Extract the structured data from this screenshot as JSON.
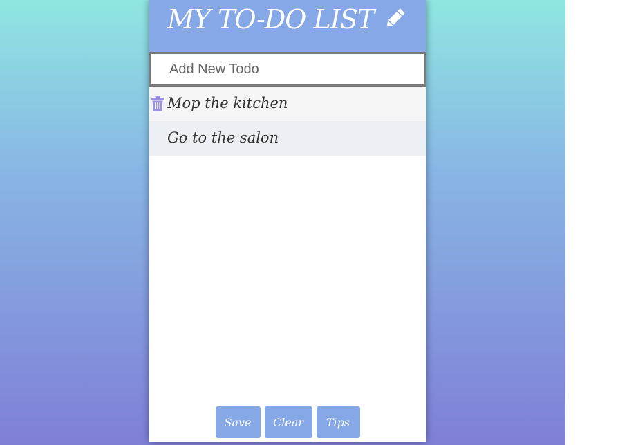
{
  "app": {
    "title": "MY TO-DO LIST",
    "header_icon": "pencil-icon"
  },
  "input": {
    "placeholder": "Add New Todo",
    "value": ""
  },
  "todos": [
    {
      "text": "Mop the kitchen",
      "icon": "trash-icon"
    },
    {
      "text": "Go to the salon"
    }
  ],
  "footer": {
    "save_label": "Save",
    "clear_label": "Clear",
    "tips_label": "Tips"
  },
  "colors": {
    "accent": "#86a8e7",
    "gradient_top": "#8fe6e1",
    "gradient_bottom": "#7f7fd6",
    "trash_icon": "#9b8fe0"
  }
}
